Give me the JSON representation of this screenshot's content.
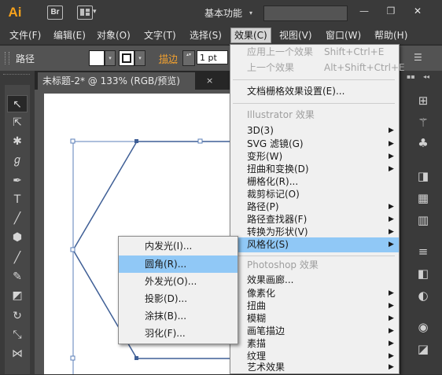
{
  "app": {
    "logo": "Ai",
    "bridge_label": "Br",
    "workspace_label": "基本功能",
    "workspace_caret": "▾",
    "arrange_caret": "▾"
  },
  "window_controls": {
    "minimize": "—",
    "maximize": "❐",
    "close": "✕"
  },
  "menubar": [
    {
      "label": "文件(F)"
    },
    {
      "label": "编辑(E)"
    },
    {
      "label": "对象(O)"
    },
    {
      "label": "文字(T)"
    },
    {
      "label": "选择(S)"
    },
    {
      "label": "效果(C)",
      "active": true
    },
    {
      "label": "视图(V)"
    },
    {
      "label": "窗口(W)"
    },
    {
      "label": "帮助(H)"
    }
  ],
  "control_bar": {
    "object_label": "路径",
    "stroke_label": "描边",
    "stroke_weight": "1 pt",
    "caret": "▾",
    "spin": "▴▾",
    "panel_menu_icon": "☰"
  },
  "document": {
    "tab_title": "未标题-2* @ 133% (RGB/预览)",
    "close_glyph": "×"
  },
  "effect_menu": {
    "apply_last": {
      "label": "应用上一个效果",
      "shortcut": "Shift+Ctrl+E"
    },
    "last_effect": {
      "label": "上一个效果",
      "shortcut": "Alt+Shift+Ctrl+E"
    },
    "raster_settings": "文档栅格效果设置(E)...",
    "illustrator_header": "Illustrator 效果",
    "illustrator_items": [
      "3D(3)",
      "SVG 滤镜(G)",
      "变形(W)",
      "扭曲和变换(D)",
      "栅格化(R)...",
      "裁剪标记(O)",
      "路径(P)",
      "路径查找器(F)",
      "转换为形状(V)",
      "风格化(S)"
    ],
    "photoshop_header": "Photoshop 效果",
    "photoshop_items": [
      "效果画廊...",
      "像素化",
      "扭曲",
      "模糊",
      "画笔描边",
      "素描",
      "纹理",
      "艺术效果"
    ],
    "submenu_arrow": "▶"
  },
  "stylize_submenu": [
    "内发光(I)...",
    "圆角(R)...",
    "外发光(O)...",
    "投影(D)...",
    "涂抹(B)...",
    "羽化(F)..."
  ],
  "tools": [
    "selection-tool",
    "direct-selection-tool",
    "magic-wand-tool",
    "lasso-tool",
    "pen-tool",
    "type-tool",
    "line-tool",
    "polygon-tool",
    "paintbrush-tool",
    "pencil-tool",
    "eraser-tool",
    "rotate-tool",
    "scale-tool",
    "width-tool"
  ],
  "right_dock": {
    "header_grip": "▪▪",
    "collapse_arrows": "◂◂"
  },
  "colors": {
    "accent_highlight": "#90c8f6",
    "logo": "#f7a21b",
    "stroke_label": "#f0a030",
    "path": "#3f5f96"
  }
}
